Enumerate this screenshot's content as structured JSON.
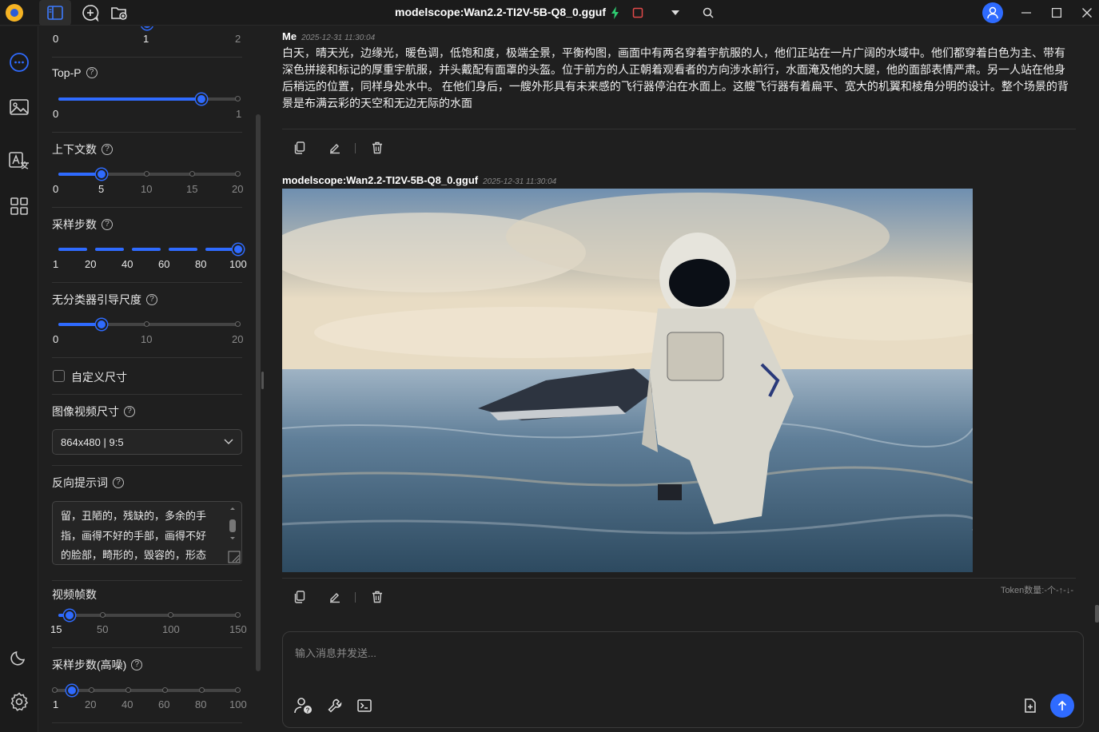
{
  "titlebar": {
    "title": "modelscope:Wan2.2-TI2V-5B-Q8_0.gguf"
  },
  "rail": {
    "items": [
      "chat-icon",
      "image-icon",
      "translate-icon",
      "apps-icon"
    ],
    "bottom": [
      "moon-icon",
      "gear-icon"
    ]
  },
  "panel": {
    "top_slider": {
      "ticks": [
        "0",
        "1",
        "2"
      ],
      "value": 1
    },
    "top_p": {
      "label": "Top-P",
      "ticks": [
        "0",
        "1"
      ],
      "value": 0.9
    },
    "context": {
      "label": "上下文数",
      "ticks": [
        "0",
        "5",
        "10",
        "15",
        "20"
      ],
      "value": 5
    },
    "steps": {
      "label": "采样步数",
      "ticks": [
        "1",
        "20",
        "40",
        "60",
        "80",
        "100"
      ],
      "value": 100
    },
    "cfg": {
      "label": "无分类器引导尺度",
      "ticks": [
        "0",
        "10",
        "20"
      ],
      "value": 5
    },
    "custom_size": {
      "label": "自定义尺寸",
      "checked": false
    },
    "size": {
      "label": "图像视频尺寸",
      "value": "864x480 | 9:5"
    },
    "negative": {
      "label": "反向提示词",
      "lines": [
        "留，丑陋的，残缺的，多余的手",
        "指，画得不好的手部，画得不好",
        "的脸部，畸形的，毁容的，形态"
      ]
    },
    "frames": {
      "label": "视频帧数",
      "ticks": [
        "15",
        "50",
        "100",
        "150"
      ],
      "value": 15
    },
    "steps_high": {
      "label": "采样步数(高噪)",
      "ticks": [
        "1",
        "20",
        "40",
        "60",
        "80",
        "100"
      ],
      "value": 1
    }
  },
  "chat": {
    "user": {
      "name": "Me",
      "time": "2025-12-31 11:30:04",
      "text": "白天，晴天光，边缘光，暖色调，低饱和度，极端全景，平衡构图，画面中有两名穿着宇航服的人，他们正站在一片广阔的水域中。他们都穿着白色为主、带有深色拼接和标记的厚重宇航服，并头戴配有面罩的头盔。位于前方的人正朝着观看者的方向涉水前行，水面淹及他的大腿，他的面部表情严肃。另一人站在他身后稍远的位置，同样身处水中。 在他们身后，一艘外形具有未来感的飞行器停泊在水面上。这艘飞行器有着扁平、宽大的机翼和棱角分明的设计。整个场景的背景是布满云彩的天空和无边无际的水面"
    },
    "model": {
      "name": "modelscope:Wan2.2-TI2V-5B-Q8_0.gguf",
      "time": "2025-12-31 11:30:04",
      "token_info": "Token数量:-个-↑-↓-"
    },
    "input": {
      "placeholder": "输入消息并发送..."
    }
  }
}
